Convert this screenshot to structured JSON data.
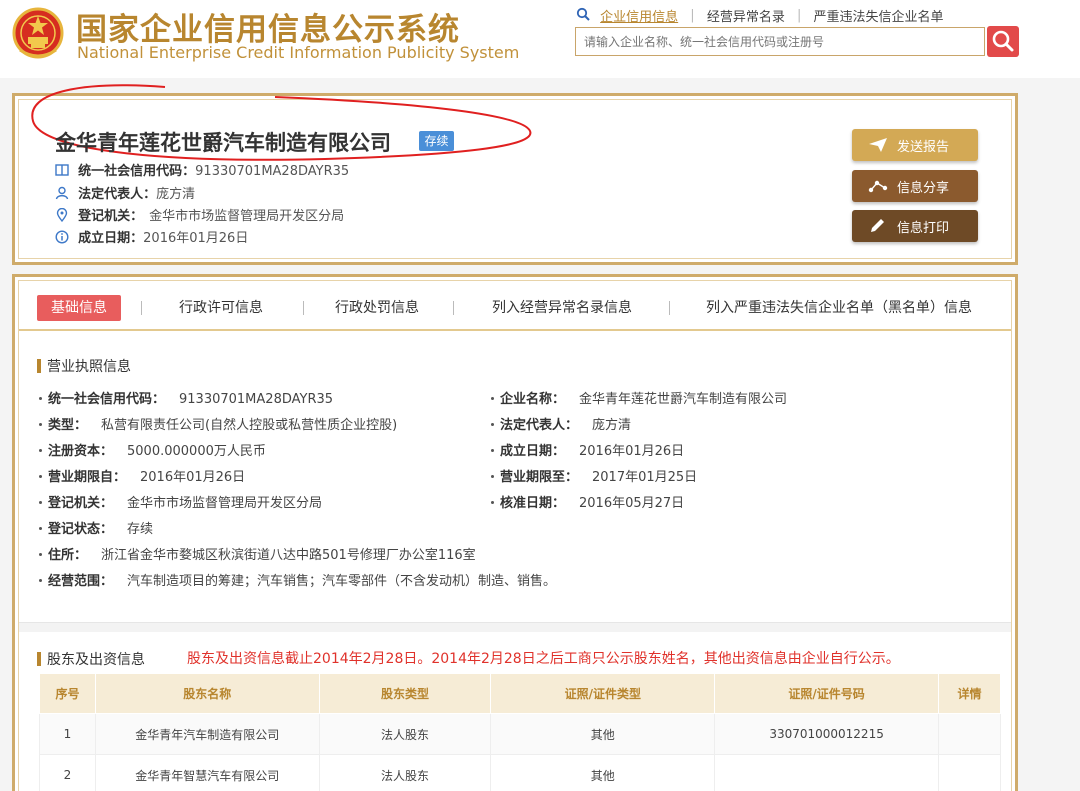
{
  "header": {
    "title_cn": "国家企业信用信息公示系统",
    "title_en": "National Enterprise Credit Information Publicity System",
    "nav": [
      "企业信用信息",
      "经营异常名录",
      "严重违法失信企业名单"
    ],
    "search_placeholder": "请输入企业名称、统一社会信用代码或注册号"
  },
  "company": {
    "name": "金华青年莲花世爵汽车制造有限公司",
    "status": "存续",
    "credit_code_label": "统一社会信用代码：",
    "credit_code": "91330701MA28DAYR35",
    "legal_rep_label": "法定代表人：",
    "legal_rep": "庞方清",
    "authority_label": "登记机关：",
    "authority": "金华市市场监督管理局开发区分局",
    "founded_label": "成立日期：",
    "founded": "2016年01月26日",
    "buttons": [
      "发送报告",
      "信息分享",
      "信息打印"
    ]
  },
  "tabs": [
    "基础信息",
    "行政许可信息",
    "行政处罚信息",
    "列入经营异常名录信息",
    "列入严重违法失信企业名单（黑名单）信息"
  ],
  "license": {
    "section_title": "营业执照信息",
    "left": [
      {
        "label": "统一社会信用代码：",
        "value": "91330701MA28DAYR35"
      },
      {
        "label": "类型：",
        "value": "私营有限责任公司(自然人控股或私营性质企业控股)"
      },
      {
        "label": "注册资本：",
        "value": "5000.000000万人民币"
      },
      {
        "label": "营业期限自：",
        "value": "2016年01月26日"
      },
      {
        "label": "登记机关：",
        "value": "金华市市场监督管理局开发区分局"
      },
      {
        "label": "登记状态：",
        "value": "存续"
      },
      {
        "label": "住所：",
        "value": "浙江省金华市婺城区秋滨街道八达中路501号修理厂办公室116室"
      },
      {
        "label": "经营范围：",
        "value": "汽车制造项目的筹建；汽车销售；汽车零部件（不含发动机）制造、销售。"
      }
    ],
    "right": [
      {
        "label": "企业名称：",
        "value": "金华青年莲花世爵汽车制造有限公司"
      },
      {
        "label": "法定代表人：",
        "value": "庞方清"
      },
      {
        "label": "成立日期：",
        "value": "2016年01月26日"
      },
      {
        "label": "营业期限至：",
        "value": "2017年01月25日"
      },
      {
        "label": "核准日期：",
        "value": "2016年05月27日"
      }
    ]
  },
  "shareholders": {
    "section_title": "股东及出资信息",
    "notice": "股东及出资信息截止2014年2月28日。2014年2月28日之后工商只公示股东姓名，其他出资信息由企业自行公示。",
    "columns": [
      "序号",
      "股东名称",
      "股东类型",
      "证照/证件类型",
      "证照/证件号码",
      "详情"
    ],
    "rows": [
      [
        "1",
        "金华青年汽车制造有限公司",
        "法人股东",
        "其他",
        "330701000012215",
        ""
      ],
      [
        "2",
        "金华青年智慧汽车有限公司",
        "法人股东",
        "其他",
        "",
        ""
      ]
    ]
  }
}
